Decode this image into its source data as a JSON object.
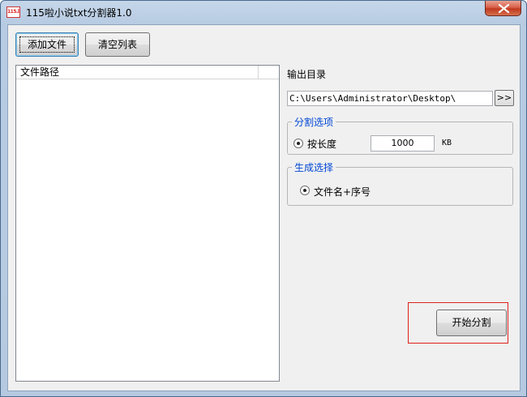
{
  "window": {
    "title": "115啦小说txt分割器1.0",
    "app_icon_text": "115.la",
    "close_icon": "close-icon"
  },
  "toolbar": {
    "add_file_label": "添加文件",
    "clear_list_label": "清空列表"
  },
  "file_list": {
    "columns": [
      "文件路径",
      ""
    ],
    "rows": []
  },
  "output": {
    "label": "输出目录",
    "path_value": "C:\\Users\\Administrator\\Desktop\\",
    "browse_label": ">>"
  },
  "split_options": {
    "title": "分割选项",
    "by_length_label": "按长度",
    "length_value": "1000",
    "unit": "KB",
    "selected": "by_length"
  },
  "generate_options": {
    "title": "生成选择",
    "filename_seq_label": "文件名+序号",
    "selected": "filename_seq"
  },
  "actions": {
    "start_split_label": "开始分割"
  },
  "colors": {
    "group_title": "#0046d5",
    "highlight_box": "#e0201a",
    "close_button": "#c7442d"
  }
}
